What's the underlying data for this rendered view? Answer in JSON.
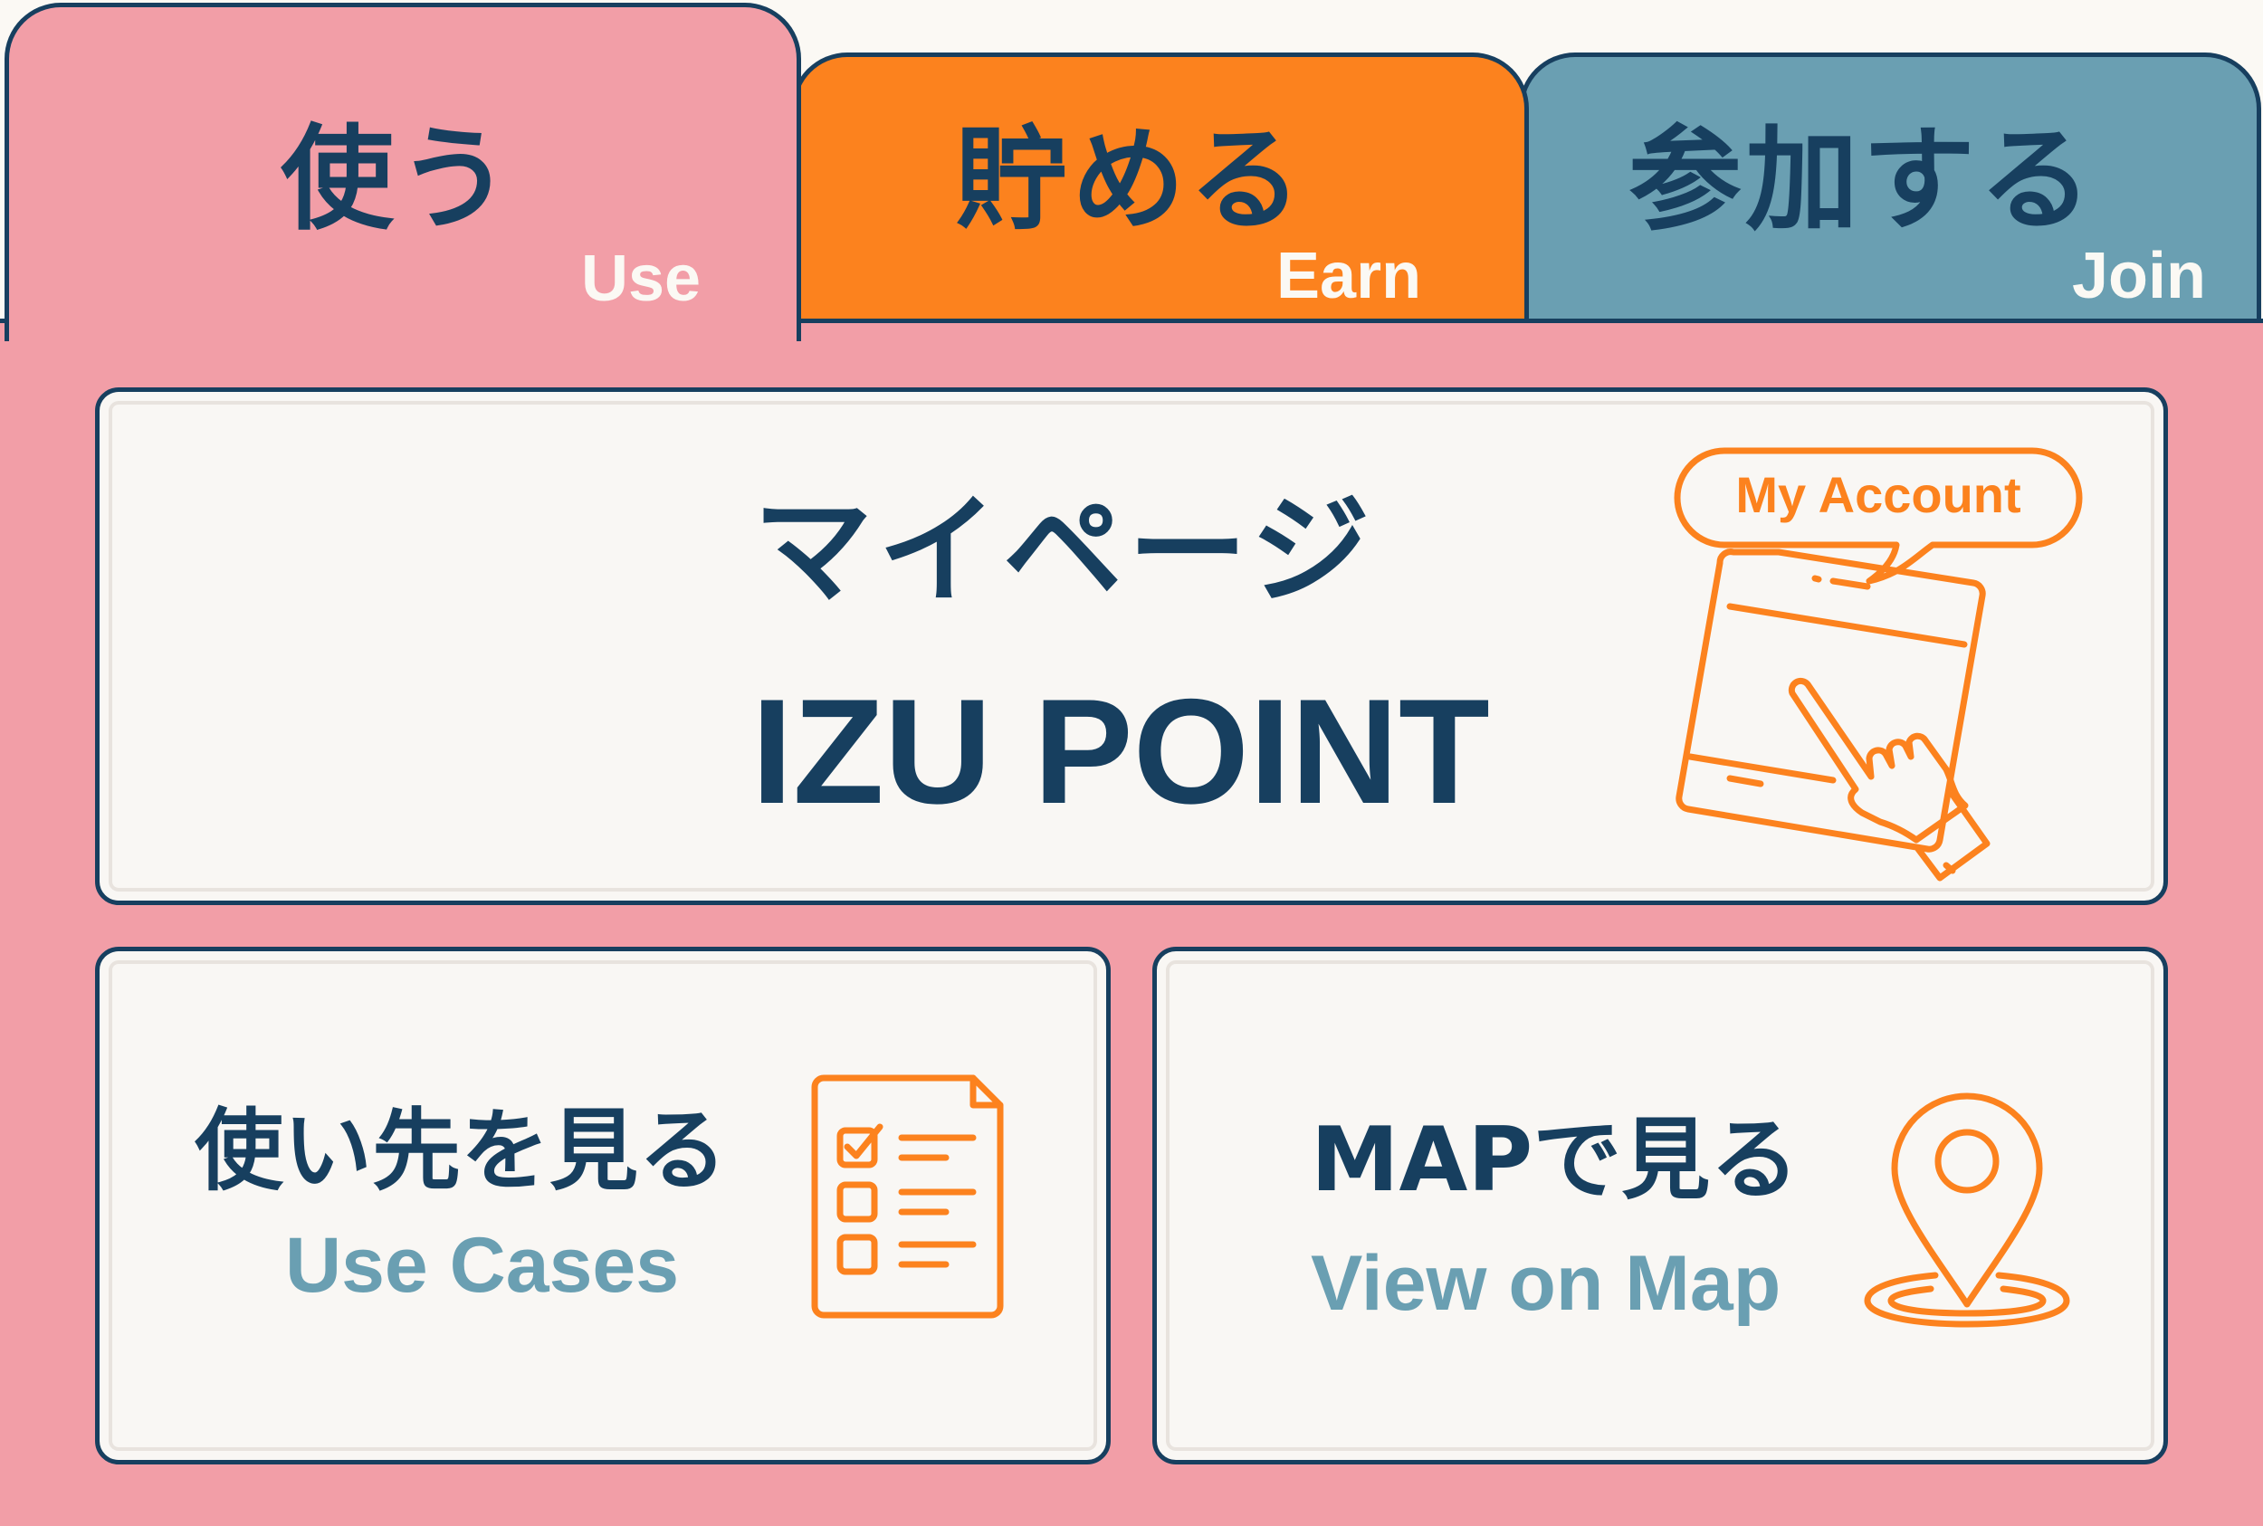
{
  "tabs": [
    {
      "jp": "使う",
      "en": "Use",
      "active": true,
      "color": "#f29ea7"
    },
    {
      "jp": "貯める",
      "en": "Earn",
      "active": false,
      "color": "#fc821e"
    },
    {
      "jp": "参加する",
      "en": "Join",
      "active": false,
      "color": "#6a9fb2"
    }
  ],
  "cards": {
    "mypage": {
      "title_jp": "マイページ",
      "title_en": "IZU POINT",
      "bubble": "My Account",
      "icon": "phone-tap-icon"
    },
    "use_cases": {
      "title_jp": "使い先を見る",
      "title_en": "Use Cases",
      "icon": "checklist-icon"
    },
    "map": {
      "title_jp": "MAPで見る",
      "title_en": "View on Map",
      "icon": "map-pin-icon"
    }
  },
  "colors": {
    "navy": "#173f5f",
    "pink": "#f29ea7",
    "orange": "#fc821e",
    "teal": "#6a9fb2",
    "card": "#f9f7f4"
  }
}
